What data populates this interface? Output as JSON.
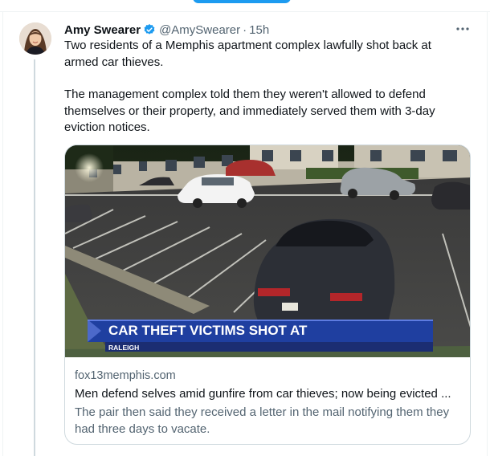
{
  "tweet": {
    "author_name": "Amy Swearer",
    "author_handle": "@AmySwearer",
    "separator": "·",
    "timestamp": "15h",
    "paragraphs": [
      "Two residents of a Memphis apartment complex lawfully shot back at armed car thieves.",
      "The management complex told them they weren't allowed to defend themselves or their property, and immediately served them with 3-day eviction notices."
    ]
  },
  "card": {
    "banner_headline": "CAR THEFT VICTIMS SHOT AT",
    "banner_location": "RALEIGH",
    "domain": "fox13memphis.com",
    "headline": "Men defend selves amid gunfire from car thieves; now being evicted ...",
    "description": "The pair then said they received a letter in the mail notifying them they had three days to vacate."
  },
  "icons": {
    "verified": "verified-badge-icon",
    "more": "more-options-icon"
  },
  "colors": {
    "accent": "#1d9bf0",
    "text_primary": "#0f1419",
    "text_secondary": "#536471",
    "banner_blue": "#1f3fa0"
  }
}
